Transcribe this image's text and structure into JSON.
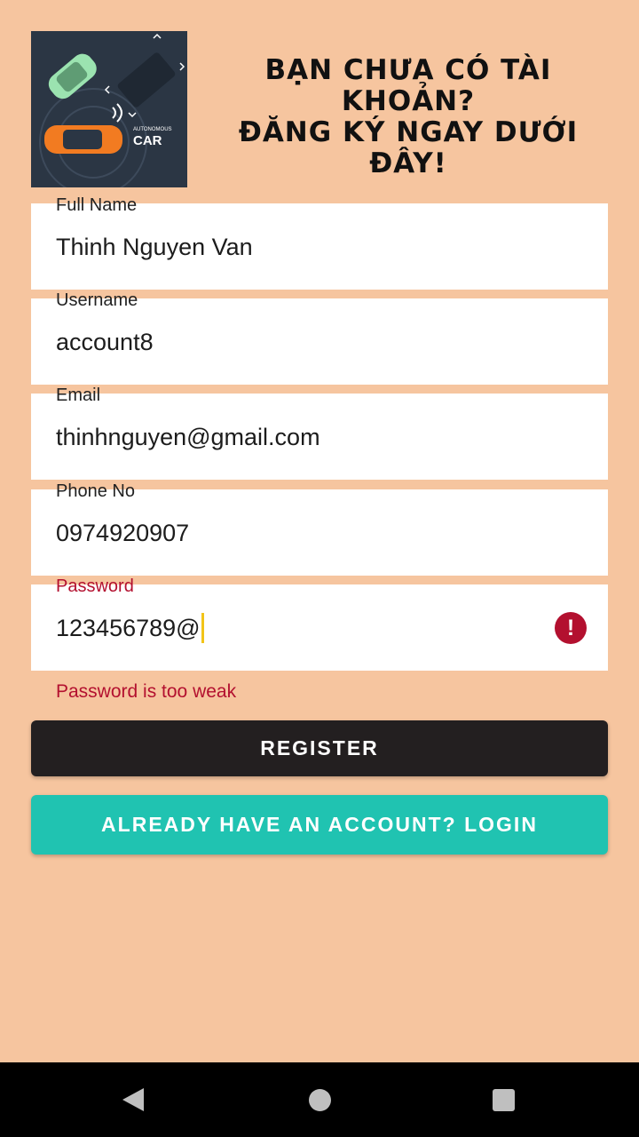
{
  "logo": {
    "brand_small": "AUTONOMOUS",
    "brand_big": "CAR"
  },
  "headline": {
    "line1": "Bạn chưa có tài",
    "line2": "khoản?",
    "line3": "Đăng ký ngay dưới",
    "line4": "đây!"
  },
  "form": {
    "full_name": {
      "label": "Full Name",
      "value": "Thinh Nguyen Van"
    },
    "username": {
      "label": "Username",
      "value": "account8"
    },
    "email": {
      "label": "Email",
      "value": "thinhnguyen@gmail.com"
    },
    "phone": {
      "label": "Phone No",
      "value": "0974920907"
    },
    "password": {
      "label": "Password",
      "value": "123456789@",
      "error": "Password is too weak",
      "error_icon": "!"
    }
  },
  "buttons": {
    "register": "REGISTER",
    "login": "ALREADY HAVE AN ACCOUNT? LOGIN"
  },
  "colors": {
    "background": "#F6C59F",
    "error": "#B3102F",
    "register_button": "#231F20",
    "login_button": "#20C3B1"
  },
  "navbar": {
    "icons": [
      "back-icon",
      "home-icon",
      "recents-icon"
    ]
  }
}
